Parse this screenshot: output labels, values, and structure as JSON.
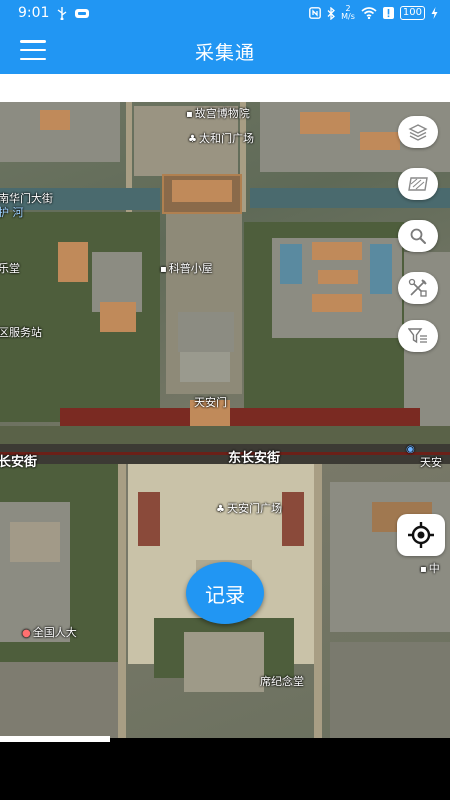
{
  "status_bar": {
    "time": "9:01",
    "net_speed_top": "2",
    "net_speed_unit": "M/s",
    "battery": "100",
    "icons": [
      "usb-icon",
      "cloud-icon",
      "nfc-icon",
      "bluetooth-icon",
      "wifi-icon",
      "alert-icon",
      "charging-icon"
    ]
  },
  "app_bar": {
    "title": "采集通",
    "menu_icon": "hamburger-menu-icon"
  },
  "map": {
    "labels": {
      "palace_museum": "故宫博物院",
      "taihemen": "太和门广场",
      "west_street": "南华门大街",
      "river": "护 河",
      "music_hall": "乐堂",
      "kepu": "科普小屋",
      "service": "区服务站",
      "tiananmen": "天安门",
      "east_changan": "东长安街",
      "changan": "长安街",
      "tiananmen_east": "天安",
      "square": "天安门广场",
      "great_hall": "全国人大",
      "mausoleum": "席纪念堂",
      "zhong": "中"
    }
  },
  "controls": {
    "layers_icon": "layers-icon",
    "basemap_icon": "satellite-basemap-icon",
    "search_icon": "search-icon",
    "tools_icon": "tools-icon",
    "filter_icon": "filter-icon",
    "locate_icon": "locate-icon",
    "record_label": "记录"
  },
  "colors": {
    "primary": "#2196f3",
    "white": "#ffffff"
  }
}
